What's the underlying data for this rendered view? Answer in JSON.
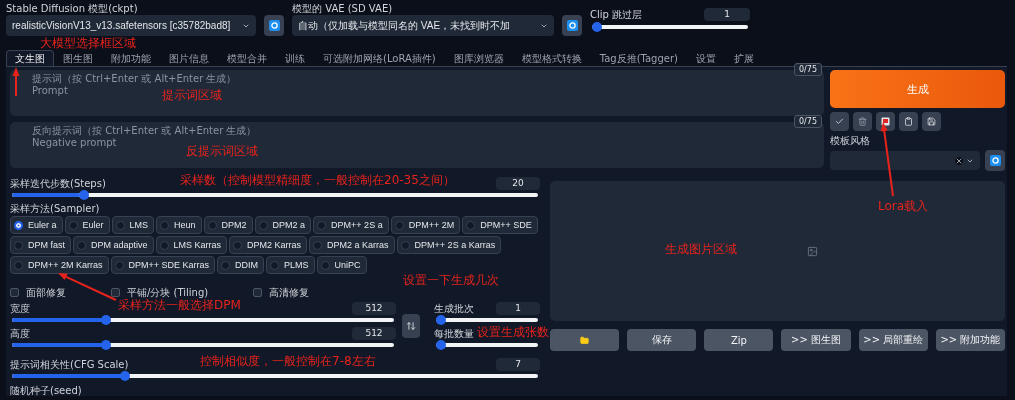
{
  "top_bar": {
    "model": {
      "label": "Stable Diffusion 模型(ckpt)",
      "value": "realisticVisionV13_v13.safetensors [c35782bad8]"
    },
    "vae": {
      "label": "模型的 VAE (SD VAE)",
      "value": "自动（仅加载与模型同名的 VAE，未找到时不加"
    },
    "clip_skip": {
      "label": "Clip 跳过层",
      "value": "1",
      "level": 0
    }
  },
  "tabs": [
    {
      "label": "文生图",
      "selected": true
    },
    {
      "label": "图生图",
      "selected": false
    },
    {
      "label": "附加功能",
      "selected": false
    },
    {
      "label": "图片信息",
      "selected": false
    },
    {
      "label": "模型合并",
      "selected": false
    },
    {
      "label": "训练",
      "selected": false
    },
    {
      "label": "可选附加网络(LoRA插件)",
      "selected": false
    },
    {
      "label": "图库浏览器",
      "selected": false
    },
    {
      "label": "模型格式转换",
      "selected": false
    },
    {
      "label": "Tag反推(Tagger)",
      "selected": false
    },
    {
      "label": "设置",
      "selected": false
    },
    {
      "label": "扩展",
      "selected": false
    }
  ],
  "prompt": {
    "placeholder": "提示词（按 Ctrl+Enter 或 Alt+Enter 生成）\nPrompt",
    "counter": "0/75"
  },
  "negative_prompt": {
    "placeholder": "反向提示词（按 Ctrl+Enter 或 Alt+Enter 生成）\nNegative prompt",
    "counter": "0/75"
  },
  "generate_button": "生成",
  "style": {
    "label": "模板风格"
  },
  "steps": {
    "label": "采样迭代步数(Steps)",
    "value": "20",
    "level": 0.13
  },
  "sampler": {
    "label": "采样方法(Sampler)",
    "options": [
      {
        "label": "Euler a",
        "selected": true
      },
      {
        "label": "Euler",
        "selected": false
      },
      {
        "label": "LMS",
        "selected": false
      },
      {
        "label": "Heun",
        "selected": false
      },
      {
        "label": "DPM2",
        "selected": false
      },
      {
        "label": "DPM2 a",
        "selected": false
      },
      {
        "label": "DPM++ 2S a",
        "selected": false
      },
      {
        "label": "DPM++ 2M",
        "selected": false
      },
      {
        "label": "DPM++ SDE",
        "selected": false
      },
      {
        "label": "DPM fast",
        "selected": false
      },
      {
        "label": "DPM adaptive",
        "selected": false
      },
      {
        "label": "LMS Karras",
        "selected": false
      },
      {
        "label": "DPM2 Karras",
        "selected": false
      },
      {
        "label": "DPM2 a Karras",
        "selected": false
      },
      {
        "label": "DPM++ 2S a Karras",
        "selected": false
      },
      {
        "label": "DPM++ 2M Karras",
        "selected": false
      },
      {
        "label": "DPM++ SDE Karras",
        "selected": false
      },
      {
        "label": "DDIM",
        "selected": false
      },
      {
        "label": "PLMS",
        "selected": false
      },
      {
        "label": "UniPC",
        "selected": false
      }
    ]
  },
  "options": [
    {
      "label": "面部修复",
      "checked": false
    },
    {
      "label": "平铺/分块 (Tiling)",
      "checked": false
    },
    {
      "label": "高清修复",
      "checked": false
    }
  ],
  "width": {
    "label": "宽度",
    "value": "512",
    "level": 0.24
  },
  "height": {
    "label": "高度",
    "value": "512",
    "level": 0.24
  },
  "batch_count": {
    "label": "生成批次",
    "value": "1",
    "level": 0
  },
  "batch_size": {
    "label": "每批数量",
    "level": 0
  },
  "cfg": {
    "label": "提示词相关性(CFG Scale)",
    "value": "7",
    "level": 0.21
  },
  "seed": {
    "label": "随机种子(seed)"
  },
  "output_buttons": [
    {
      "kind": "folder"
    },
    {
      "kind": "text",
      "label": "保存"
    },
    {
      "kind": "text",
      "label": "Zip"
    },
    {
      "kind": "text",
      "label": ">> 图生图"
    },
    {
      "kind": "text",
      "label": ">> 局部重绘"
    },
    {
      "kind": "text",
      "label": ">> 附加功能"
    }
  ],
  "annotations": [
    {
      "text": "大模型选择框区域",
      "arrow": true
    },
    {
      "text": "提示词区域",
      "arrow": false
    },
    {
      "text": "反提示词区域",
      "arrow": false
    },
    {
      "text": "采样数（控制模型精细度，一般控制在20-35之间）",
      "arrow": false
    },
    {
      "text": "Lora载入",
      "arrow": true
    },
    {
      "text": "生成图片区域",
      "arrow": false
    },
    {
      "text": "设置一下生成几次",
      "arrow": false
    },
    {
      "text": "采样方法一般选择DPM",
      "arrow": true
    },
    {
      "text": "设置生成张数",
      "arrow": false
    },
    {
      "text": "控制相似度，一般控制在7-8左右",
      "arrow": false
    }
  ]
}
